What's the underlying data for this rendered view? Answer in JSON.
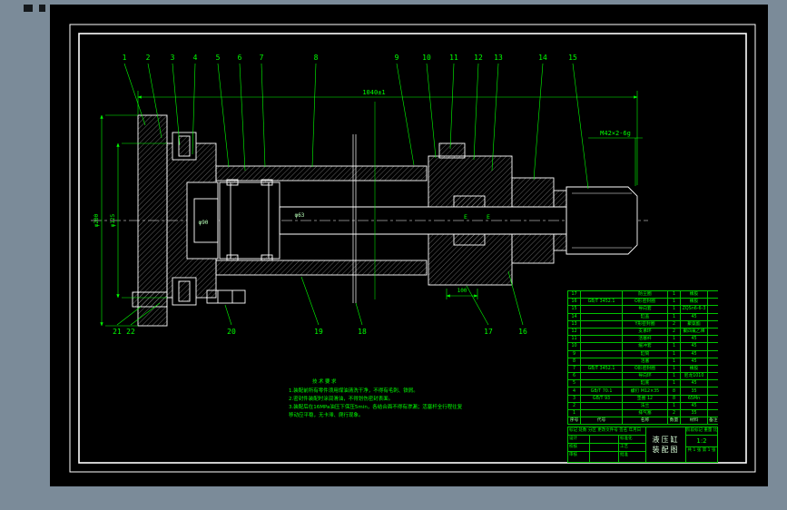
{
  "colors": {
    "surround": "#7b8b99",
    "paper": "#000000",
    "line_white": "#ffffff",
    "annotation_green": "#00ff00"
  },
  "drawing": {
    "balloons_top": [
      "1",
      "2",
      "3",
      "4",
      "5",
      "6",
      "7",
      "8",
      "9",
      "10",
      "11",
      "12",
      "13",
      "14",
      "15"
    ],
    "balloons_bottom": [
      "21",
      "22",
      "20",
      "19",
      "18",
      "17",
      "16"
    ],
    "dims": {
      "overall": "1040±1",
      "flange_od": "φ200",
      "head_od": "φ125",
      "bore": "φ90",
      "rod": "φ63",
      "gland": "100",
      "thread": "M42×2-6g",
      "vent_mark_1": "E",
      "vent_mark_2": "E"
    }
  },
  "notes": {
    "title": "技术要求",
    "lines": [
      "1.装配前所有零件须用煤油清洗干净，不得有毛刺、铁屑。",
      "2.密封件装配时涂润滑油，不得划伤密封表面。",
      "3.装配后在16MPa油压下保压5min，各结合面不得有渗漏；活塞杆全行程往复移动应平稳，无卡滞、爬行现象。"
    ]
  },
  "bom": {
    "headers": [
      "序号",
      "代号",
      "名称",
      "数量",
      "材料",
      "备注"
    ],
    "rows": [
      [
        "17",
        "",
        "防尘圈",
        "1",
        "橡胶",
        ""
      ],
      [
        "16",
        "GB/T 3452.1",
        "O形密封圈",
        "1",
        "橡胶",
        ""
      ],
      [
        "15",
        "",
        "导向套",
        "1",
        "ZQSn6-6-3",
        ""
      ],
      [
        "14",
        "",
        "缸盖",
        "1",
        "45",
        ""
      ],
      [
        "13",
        "",
        "Y形密封圈",
        "2",
        "聚氨酯",
        ""
      ],
      [
        "12",
        "",
        "支承环",
        "2",
        "聚四氟乙烯",
        ""
      ],
      [
        "11",
        "",
        "活塞杆",
        "1",
        "45",
        ""
      ],
      [
        "10",
        "",
        "缓冲套",
        "1",
        "45",
        ""
      ],
      [
        "9",
        "",
        "缸筒",
        "1",
        "45",
        ""
      ],
      [
        "8",
        "",
        "活塞",
        "1",
        "45",
        ""
      ],
      [
        "7",
        "GB/T 3452.1",
        "O形密封圈",
        "1",
        "橡胶",
        ""
      ],
      [
        "6",
        "",
        "导向环",
        "1",
        "尼龙1010",
        ""
      ],
      [
        "5",
        "",
        "缸底",
        "1",
        "45",
        ""
      ],
      [
        "4",
        "GB/T 70.1",
        "螺钉 M12×35",
        "8",
        "35",
        ""
      ],
      [
        "3",
        "GB/T 93",
        "垫圈 12",
        "8",
        "65Mn",
        ""
      ],
      [
        "2",
        "",
        "法兰",
        "1",
        "45",
        ""
      ],
      [
        "1",
        "",
        "排气塞",
        "2",
        "35",
        ""
      ]
    ]
  },
  "titleblock": {
    "marks_row": "标记 处数 分区 更改文件号 签名 年月日",
    "design": "设计",
    "standard": "标准化",
    "check": "校核",
    "craft": "工艺",
    "audit": "审核",
    "approve": "批准",
    "stage_row": "阶段标记  重量  比例",
    "scale": "1:2",
    "sheets": "共 1 张 第 1 张",
    "title_line1": "液压缸",
    "title_line2": "装配图"
  }
}
